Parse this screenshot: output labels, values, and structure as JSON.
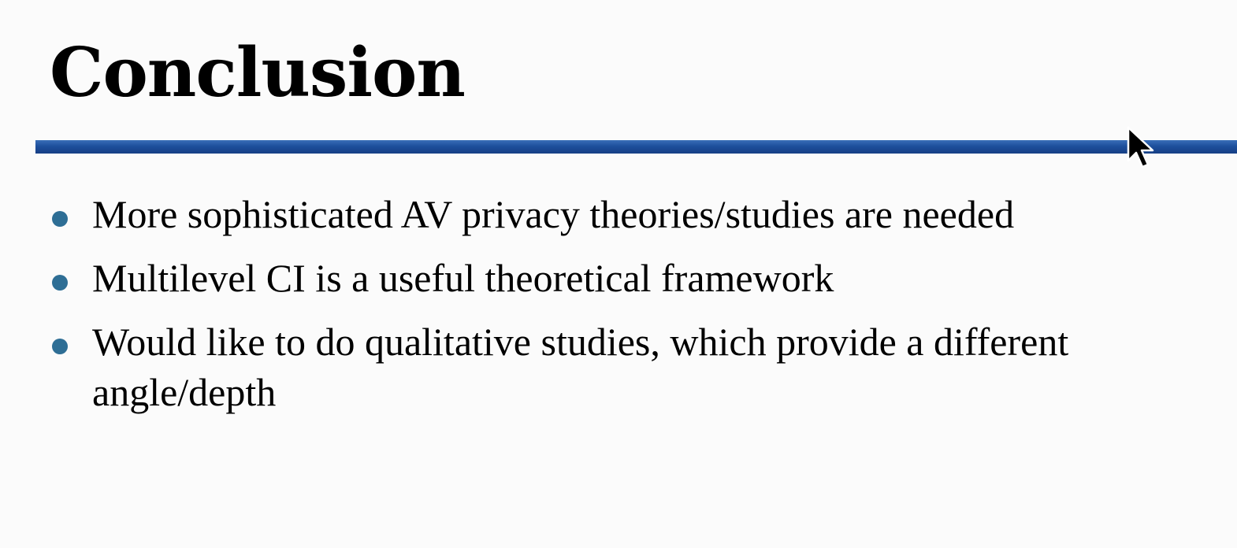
{
  "slide": {
    "title": "Conclusion",
    "bullets": [
      {
        "text": "More sophisticated AV privacy theories/studies are needed"
      },
      {
        "text": "Multilevel CI is a useful theoretical framework"
      },
      {
        "text": "Would like to do qualitative studies, which provide a different angle/depth"
      }
    ]
  },
  "colors": {
    "title_rule": "#1d4f9c",
    "bullet_dot": "#2e6e95",
    "background": "#fbfbfb",
    "text": "#000000"
  },
  "icons": {
    "pointer": "mouse-pointer-icon"
  }
}
